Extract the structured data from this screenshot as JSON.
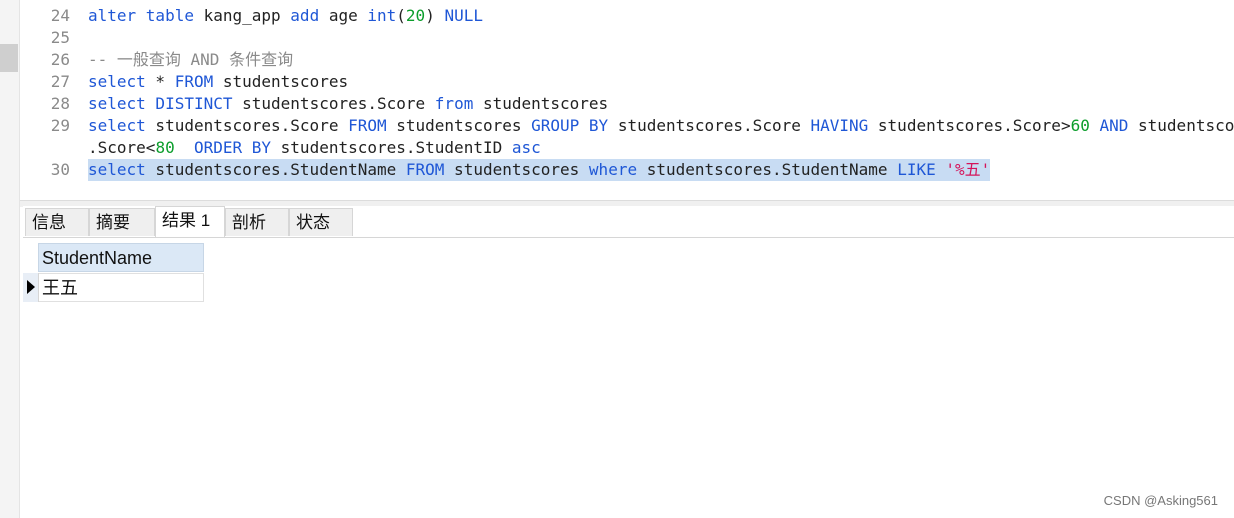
{
  "editor": {
    "lines": [
      {
        "num": "24",
        "segments": [
          {
            "t": "alter table",
            "c": "kw"
          },
          {
            "t": " kang_app ",
            "c": ""
          },
          {
            "t": "add",
            "c": "kw"
          },
          {
            "t": " age ",
            "c": ""
          },
          {
            "t": "int",
            "c": "kw"
          },
          {
            "t": "(",
            "c": ""
          },
          {
            "t": "20",
            "c": "num"
          },
          {
            "t": ") ",
            "c": ""
          },
          {
            "t": "NULL",
            "c": "kw"
          }
        ]
      },
      {
        "num": "25",
        "segments": []
      },
      {
        "num": "26",
        "segments": [
          {
            "t": "-- 一般查询 AND 条件查询",
            "c": "cmt"
          }
        ]
      },
      {
        "num": "27",
        "segments": [
          {
            "t": "select",
            "c": "kw"
          },
          {
            "t": " * ",
            "c": ""
          },
          {
            "t": "FROM",
            "c": "kw"
          },
          {
            "t": " studentscores",
            "c": ""
          }
        ]
      },
      {
        "num": "28",
        "segments": [
          {
            "t": "select DISTINCT",
            "c": "kw"
          },
          {
            "t": " studentscores.Score ",
            "c": ""
          },
          {
            "t": "from",
            "c": "kw"
          },
          {
            "t": " studentscores",
            "c": ""
          }
        ]
      },
      {
        "num": "29",
        "segments": [
          {
            "t": "select",
            "c": "kw"
          },
          {
            "t": " studentscores.Score ",
            "c": ""
          },
          {
            "t": "FROM",
            "c": "kw"
          },
          {
            "t": " studentscores ",
            "c": ""
          },
          {
            "t": "GROUP BY",
            "c": "kw"
          },
          {
            "t": " studentscores.Score ",
            "c": ""
          },
          {
            "t": "HAVING",
            "c": "kw"
          },
          {
            "t": " studentscores.Score>",
            "c": ""
          },
          {
            "t": "60",
            "c": "num"
          },
          {
            "t": " ",
            "c": ""
          },
          {
            "t": "AND",
            "c": "kw"
          },
          {
            "t": " studentscores",
            "c": ""
          }
        ]
      },
      {
        "num": "",
        "segments": [
          {
            "t": ".Score<",
            "c": ""
          },
          {
            "t": "80",
            "c": "num"
          },
          {
            "t": "  ",
            "c": ""
          },
          {
            "t": "ORDER BY",
            "c": "kw"
          },
          {
            "t": " studentscores.StudentID ",
            "c": ""
          },
          {
            "t": "asc",
            "c": "kw"
          }
        ]
      },
      {
        "num": "30",
        "highlight": true,
        "segments": [
          {
            "t": "select",
            "c": "kw"
          },
          {
            "t": " studentscores.StudentName ",
            "c": ""
          },
          {
            "t": "FROM",
            "c": "kw"
          },
          {
            "t": " studentscores ",
            "c": ""
          },
          {
            "t": "where",
            "c": "kw"
          },
          {
            "t": " studentscores.StudentName ",
            "c": ""
          },
          {
            "t": "LIKE",
            "c": "kw"
          },
          {
            "t": " ",
            "c": ""
          },
          {
            "t": "'%五'",
            "c": "str"
          }
        ]
      }
    ]
  },
  "tabs": [
    {
      "label": "信息",
      "active": false
    },
    {
      "label": "摘要",
      "active": false
    },
    {
      "label": "结果 1",
      "active": true
    },
    {
      "label": "剖析",
      "active": false
    },
    {
      "label": "状态",
      "active": false
    }
  ],
  "results": {
    "columns": [
      "StudentName"
    ],
    "rows": [
      [
        "王五"
      ]
    ]
  },
  "watermark": "CSDN @Asking561",
  "colors": {
    "keyword": "#1f57d6",
    "number": "#0c9e2c",
    "string": "#d4145a",
    "comment": "#8a8a8a",
    "selection": "#c8dcf3",
    "grid_header": "#dbe8f6"
  }
}
